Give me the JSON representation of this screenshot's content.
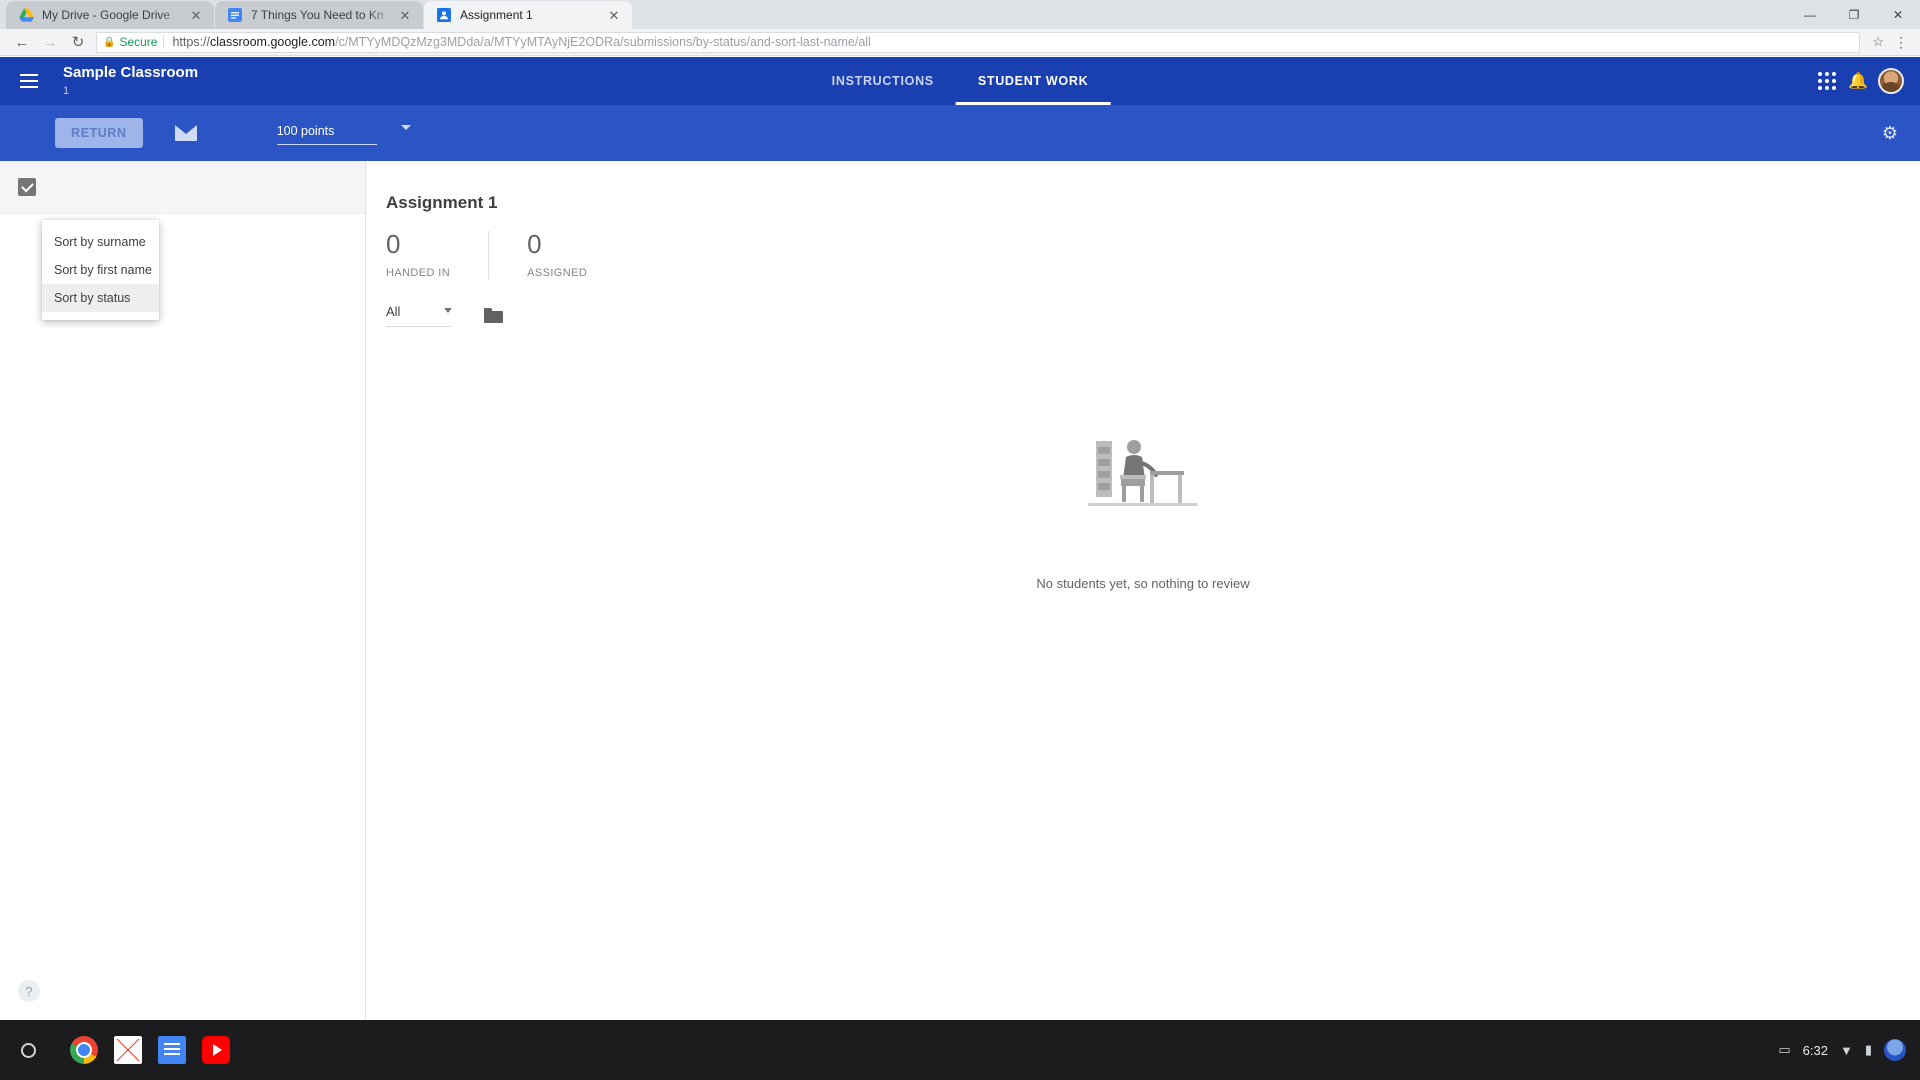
{
  "browser": {
    "tabs": [
      {
        "title": "My Drive - Google Drive",
        "favicon": "drive-icon",
        "close": "✕",
        "active": false
      },
      {
        "title": "7 Things You Need to Kn",
        "favicon": "docs-icon",
        "close": "✕",
        "active": false
      },
      {
        "title": "Assignment 1",
        "favicon": "classroom-icon",
        "close": "✕",
        "active": true
      }
    ],
    "window_controls": {
      "minimize": "—",
      "maximize": "❐",
      "close": "✕"
    },
    "nav": {
      "back": "←",
      "forward": "→",
      "reload": "↻"
    },
    "omnibox": {
      "security_icon": "lock-icon",
      "security_label": "Secure",
      "url_scheme": "https://",
      "url_host": "classroom.google.com",
      "url_path": "/c/MTYyMDQzMzg3MDda/a/MTYyMTAyNjE2ODRa/submissions/by-status/and-sort-last-name/all",
      "full_url": "https://classroom.google.com/c/MTYyMDQzMzg3MDda/a/MTYyMTAyNjE2ODRa/submissions/by-status/and-sort-last-name/all",
      "bookmark_star": "☆",
      "menu": "⋮"
    }
  },
  "classroom": {
    "header": {
      "menu_icon": "hamburger-icon",
      "class_name": "Sample Classroom",
      "class_section": "1",
      "tabs": [
        {
          "label": "INSTRUCTIONS",
          "selected": false
        },
        {
          "label": "STUDENT WORK",
          "selected": true
        }
      ],
      "apps_icon": "apps-grid-icon",
      "notifications_icon": "bell-icon",
      "account_icon": "avatar"
    },
    "toolbar": {
      "return_label": "RETURN",
      "return_disabled": true,
      "email_icon": "mail-icon",
      "points_value": "100 points",
      "points_caret": "chevron-down-icon",
      "settings_icon": "gear-icon"
    },
    "left_panel": {
      "select_all_checked": true,
      "sort_menu": {
        "items": [
          {
            "label": "Sort by surname",
            "hovered": false
          },
          {
            "label": "Sort by first name",
            "hovered": false
          },
          {
            "label": "Sort by status",
            "hovered": true
          }
        ]
      },
      "help_label": "?"
    },
    "main": {
      "assignment_title": "Assignment 1",
      "stats": [
        {
          "value": "0",
          "label": "HANDED IN"
        },
        {
          "value": "0",
          "label": "ASSIGNED"
        }
      ],
      "filter_value": "All",
      "filter_caret": "chevron-down-icon",
      "folder_icon": "folder-icon",
      "empty_state": {
        "illustration": "person-at-desk-illustration",
        "message": "No students yet, so nothing to review"
      }
    }
  },
  "shelf": {
    "launcher_icon": "launcher-circle-icon",
    "apps": [
      {
        "name": "chrome-icon"
      },
      {
        "name": "gmail-icon"
      },
      {
        "name": "docs-icon"
      },
      {
        "name": "youtube-icon"
      }
    ],
    "tray": {
      "screen_icon": "▭",
      "time": "6:32",
      "wifi_icon": "▼",
      "battery_icon": "▮",
      "user_icon": "avatar"
    }
  },
  "colors": {
    "chrome_tabstrip": "#dee1e6",
    "classroom_header": "#1a3fb0",
    "classroom_toolbar": "#2b55c4",
    "secure_green": "#0f9d58",
    "shelf": "#1c1c1e"
  }
}
